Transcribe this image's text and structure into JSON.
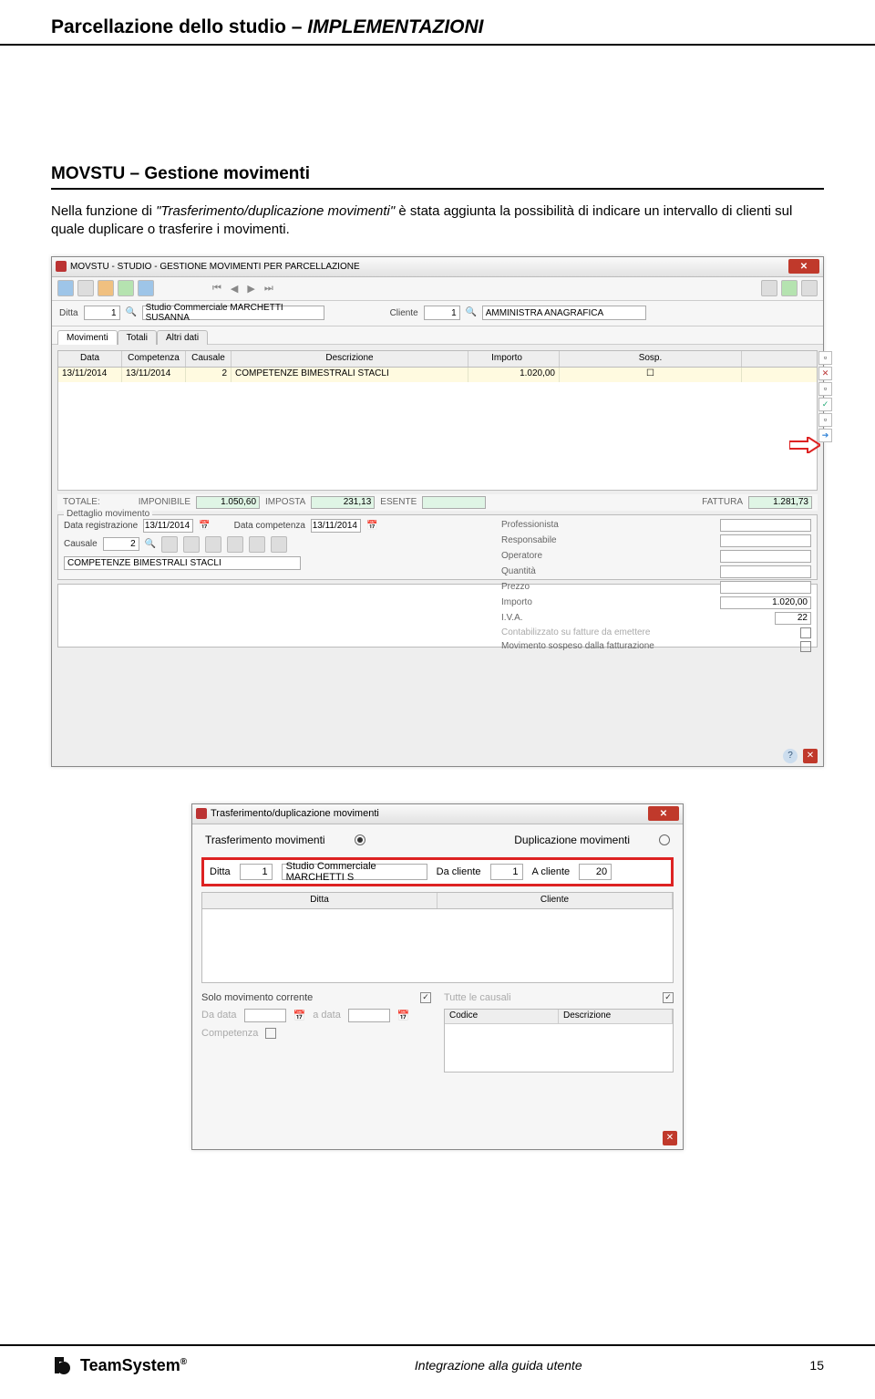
{
  "header": {
    "title_left": "Parcellazione dello studio – ",
    "title_right": "IMPLEMENTAZIONI"
  },
  "section": {
    "title": "MOVSTU – Gestione movimenti",
    "para_a": "Nella funzione di ",
    "para_ital": "\"Trasferimento/duplicazione movimenti\"",
    "para_b": " è stata aggiunta la possibilità di indicare un intervallo di clienti sul quale duplicare o trasferire i movimenti."
  },
  "win1": {
    "title": "MOVSTU - STUDIO - GESTIONE MOVIMENTI PER PARCELLAZIONE",
    "filter": {
      "ditta_lbl": "Ditta",
      "ditta_val": "1",
      "ditta_name": "Studio Commerciale MARCHETTI SUSANNA",
      "cliente_lbl": "Cliente",
      "cliente_val": "1",
      "cliente_name": "AMMINISTRA ANAGRAFICA"
    },
    "tabs": {
      "t1": "Movimenti",
      "t2": "Totali",
      "t3": "Altri dati"
    },
    "grid": {
      "h1": "Data",
      "h2": "Competenza",
      "h3": "Causale",
      "h4": "Descrizione",
      "h5": "Importo",
      "h6": "Sosp.",
      "r1": {
        "data": "13/11/2014",
        "comp": "13/11/2014",
        "caus": "2",
        "descr": "COMPETENZE BIMESTRALI STACLI",
        "imp": "1.020,00"
      }
    },
    "totals": {
      "totale": "TOTALE:",
      "imponibile": "IMPONIBILE",
      "imponibile_v": "1.050,60",
      "imposta": "IMPOSTA",
      "imposta_v": "231,13",
      "esente": "ESENTE",
      "esente_v": "",
      "fattura": "FATTURA",
      "fattura_v": "1.281,73"
    },
    "detail": {
      "title": "Dettaglio movimento",
      "datareg_lbl": "Data registrazione",
      "datareg_v": "13/11/2014",
      "datacomp_lbl": "Data competenza",
      "datacomp_v": "13/11/2014",
      "causale_lbl": "Causale",
      "causale_v": "2",
      "descr_v": "COMPETENZE BIMESTRALI STACLI",
      "r": {
        "prof": "Professionista",
        "resp": "Responsabile",
        "oper": "Operatore",
        "quant": "Quantità",
        "prezzo": "Prezzo",
        "importo": "Importo",
        "importo_v": "1.020,00",
        "iva": "I.V.A.",
        "iva_v": "22",
        "cont": "Contabilizzato su fatture da emettere",
        "sosp": "Movimento sospeso dalla fatturazione"
      }
    }
  },
  "win2": {
    "title": "Trasferimento/duplicazione movimenti",
    "opt1": "Trasferimento movimenti",
    "opt2": "Duplicazione movimenti",
    "row": {
      "ditta_lbl": "Ditta",
      "ditta_v": "1",
      "ditta_name": "Studio Commerciale MARCHETTI S",
      "dacli_lbl": "Da cliente",
      "dacli_v": "1",
      "acli_lbl": "A cliente",
      "acli_v": "20"
    },
    "list": {
      "h1": "Ditta",
      "h2": "Cliente"
    },
    "left": {
      "solo": "Solo movimento corrente",
      "dadata": "Da data",
      "adata": "a data",
      "competenza": "Competenza"
    },
    "right": {
      "tutte": "Tutte le causali",
      "codice": "Codice",
      "descr": "Descrizione"
    }
  },
  "footer": {
    "logo": "TeamSystem",
    "center": "Integrazione alla guida utente",
    "page": "15"
  }
}
